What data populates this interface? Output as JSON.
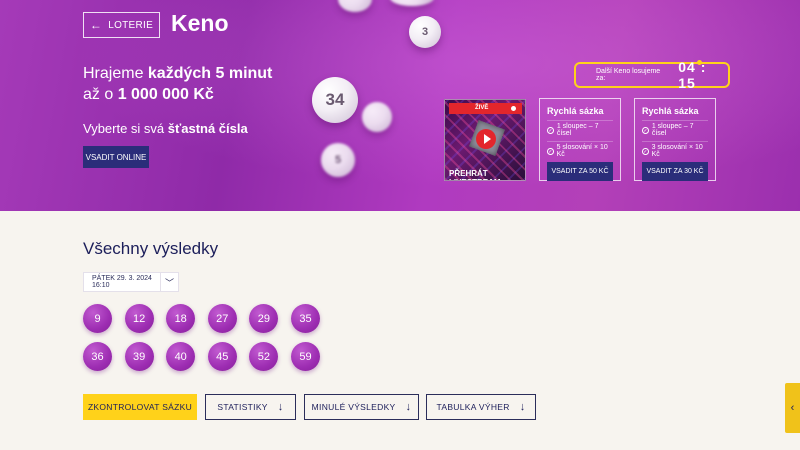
{
  "hero": {
    "back_label": "LOTERIE",
    "title": "Keno",
    "headline_prefix": "Hrajeme ",
    "headline_bold1": "každých 5 minut",
    "headline_mid": "až o ",
    "headline_bold2": "1 000 000 Kč",
    "tagline_prefix": "Vyberte si svá ",
    "tagline_bold": "šťastná čísla",
    "bet_online": "VSADIT ONLINE",
    "balls": [
      "3",
      "34",
      "5"
    ]
  },
  "countdown": {
    "label": "Další Keno losujeme za:",
    "time": "04 : 15"
  },
  "livestream": {
    "badge": "ŽIVĚ",
    "label": "PŘEHRÁT LIVESTREAM"
  },
  "quick_bets": [
    {
      "title": "Rychlá sázka",
      "line1": "1 sloupec – 7 čísel",
      "line2": "5 slosování × 10 Kč",
      "button": "VSADIT ZA 50 KČ"
    },
    {
      "title": "Rychlá sázka",
      "line1": "1 sloupec – 7 čísel",
      "line2": "3 slosování × 10 Kč",
      "button": "VSADIT ZA 30 KČ"
    }
  ],
  "results": {
    "title": "Všechny výsledky",
    "date": "PÁTEK 29. 3. 2024 16:10",
    "numbers": [
      "9",
      "12",
      "18",
      "27",
      "29",
      "35",
      "36",
      "39",
      "40",
      "45",
      "52",
      "59"
    ]
  },
  "actions": {
    "check": "ZKONTROLOVAT SÁZKU",
    "stats": "STATISTIKY",
    "past": "MINULÉ VÝSLEDKY",
    "prizes": "TABULKA VÝHER"
  },
  "colors": {
    "brand_purple": "#9d2db2",
    "navy": "#2b2d7a",
    "accent_yellow": "#ffd21a"
  }
}
